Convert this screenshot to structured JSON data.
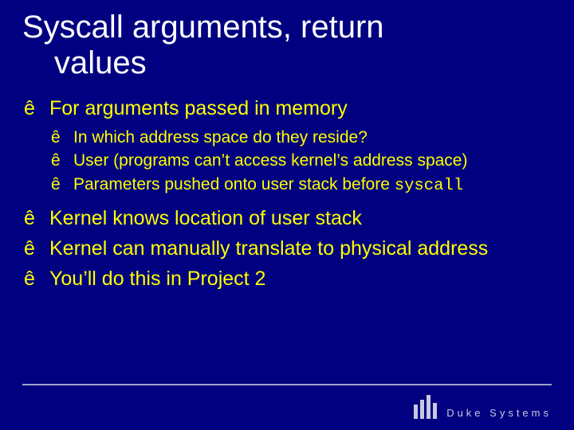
{
  "title_line1": "Syscall arguments, return",
  "title_line2": "values",
  "bullets": [
    {
      "text": "For arguments passed in memory",
      "sub": [
        "In which address space do they reside?",
        "User (programs can’t access kernel’s address space)",
        "Parameters pushed onto user stack before "
      ],
      "sub_code_tail": "syscall"
    },
    {
      "text": "Kernel knows location of user stack"
    },
    {
      "text": "Kernel can manually translate to physical address"
    },
    {
      "text": "You’ll do this in Project 2"
    }
  ],
  "brand": "Duke Systems"
}
